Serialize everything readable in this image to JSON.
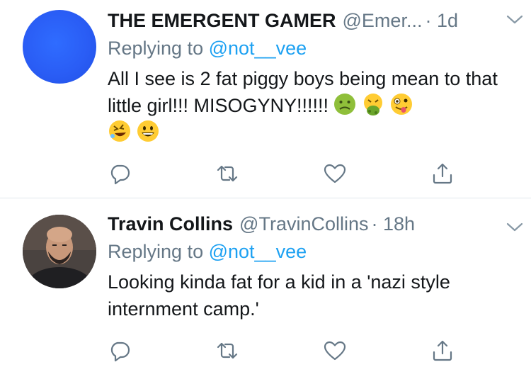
{
  "tweets": [
    {
      "display_name": "THE EMERGENT GAMER",
      "handle": "@Emer...",
      "time": "· 1d",
      "reply_prefix": "Replying to",
      "reply_handle": "@not__vee",
      "text": "All I see is 2 fat piggy boys being mean to that little girl!!! MISOGYNY!!!!!!",
      "emojis": [
        "nauseated-face",
        "vomiting-face",
        "zany-face",
        "rolling-on-floor-laughing",
        "grinning-face"
      ],
      "avatar": "solid-blue-circle"
    },
    {
      "display_name": "Travin Collins",
      "handle": "@TravinCollins",
      "time": "· 18h",
      "reply_prefix": "Replying to",
      "reply_handle": "@not__vee",
      "text": "Looking kinda fat for a kid in a 'nazi style internment camp.'",
      "emojis": [],
      "avatar": "profile-photo"
    }
  ],
  "icons": [
    "reply-icon",
    "retweet-icon",
    "like-icon",
    "share-icon",
    "chevron-down-icon"
  ],
  "colors": {
    "link": "#1da1f2",
    "muted": "#657786",
    "text": "#14171a",
    "divider": "#e1e8ed"
  }
}
